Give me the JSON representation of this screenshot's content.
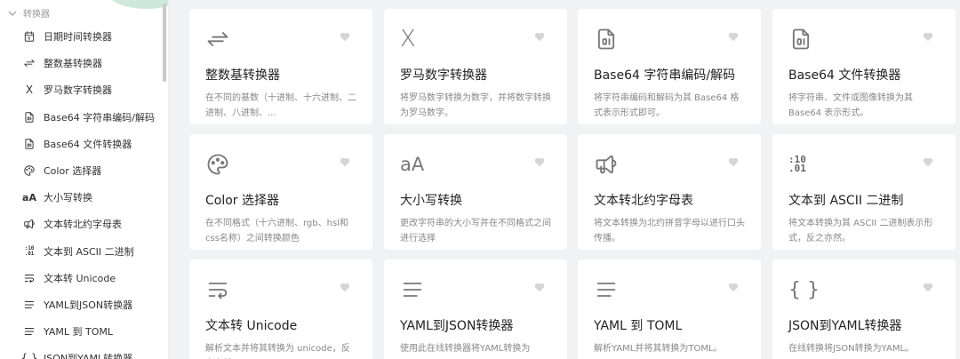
{
  "sidebar": {
    "section_title": "转换器",
    "items": [
      {
        "label": "日期时间转换器",
        "icon": "calendar-icon"
      },
      {
        "label": "整数基转换器",
        "icon": "arrows-exchange-icon"
      },
      {
        "label": "罗马数字转换器",
        "icon": "roman-x-icon",
        "glyph": "X"
      },
      {
        "label": "Base64 字符串编码/解码",
        "icon": "file-digit-icon"
      },
      {
        "label": "Base64 文件转换器",
        "icon": "file-digit-icon"
      },
      {
        "label": "Color 选择器",
        "icon": "palette-icon"
      },
      {
        "label": "大小写转换",
        "icon": "letter-case-icon",
        "glyph": "aA"
      },
      {
        "label": "文本转北约字母表",
        "icon": "speakerphone-icon"
      },
      {
        "label": "文本到 ASCII 二进制",
        "icon": "binary-icon",
        "glyph": ":10\n.01"
      },
      {
        "label": "文本转 Unicode",
        "icon": "text-wrap-icon"
      },
      {
        "label": "YAML到JSON转换器",
        "icon": "align-justified-icon"
      },
      {
        "label": "YAML 到 TOML",
        "icon": "align-justified-icon"
      },
      {
        "label": "JSON到YAML转换器",
        "icon": "braces-icon",
        "glyph": "{ }"
      }
    ]
  },
  "cards": [
    {
      "title": "整数基转换器",
      "desc": "在不同的基数（十进制、十六进制、二进制、八进制、...",
      "icon": "arrows-exchange-icon"
    },
    {
      "title": "罗马数字转换器",
      "desc": "将罗马数字转换为数字，并将数字转换为罗马数字。",
      "icon": "roman-x-icon",
      "glyph": "X"
    },
    {
      "title": "Base64 字符串编码/解码",
      "desc": "将字符串编码和解码为其 Base64 格式表示形式即可。",
      "icon": "file-digit-icon"
    },
    {
      "title": "Base64 文件转换器",
      "desc": "将字符串、文件或图像转换为其 Base64 表示形式。",
      "icon": "file-digit-icon"
    },
    {
      "title": "Color 选择器",
      "desc": "在不同格式（十六进制、rgb、hsl和css名称）之间转换颜色",
      "icon": "palette-icon"
    },
    {
      "title": "大小写转换",
      "desc": "更改字符串的大小写并在不同格式之间进行选择",
      "icon": "letter-case-icon",
      "glyph": "aA"
    },
    {
      "title": "文本转北约字母表",
      "desc": "将文本转换为北约拼音字母以进行口头传播。",
      "icon": "speakerphone-icon"
    },
    {
      "title": "文本到 ASCII 二进制",
      "desc": "将文本转换为其 ASCII 二进制表示形式，反之亦然。",
      "icon": "binary-icon",
      "glyph": ":10\n.01"
    },
    {
      "title": "文本转 Unicode",
      "desc": "解析文本并将其转换为 unicode，反之亦然",
      "icon": "text-wrap-icon"
    },
    {
      "title": "YAML到JSON转换器",
      "desc": "使用此在线转换器将YAML转换为JSON。",
      "icon": "align-justified-icon"
    },
    {
      "title": "YAML 到 TOML",
      "desc": "解析YAML并将其转换为TOML。",
      "icon": "align-justified-icon"
    },
    {
      "title": "JSON到YAML转换器",
      "desc": "在线转换将JSON转换为YAML。",
      "icon": "braces-icon",
      "glyph": "{ }"
    }
  ],
  "colors": {
    "accent_blob": "#cfe8dc",
    "heart": "#d5d5d5",
    "icon_gray": "#777777"
  }
}
